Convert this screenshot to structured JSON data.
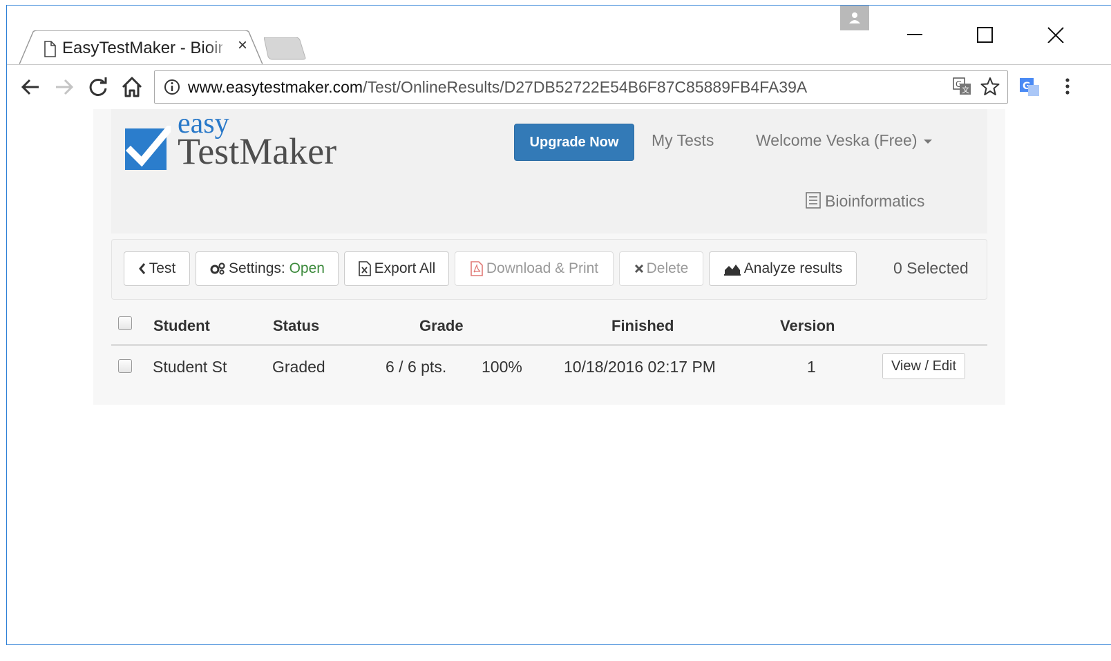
{
  "browser": {
    "tab_title": "EasyTestMaker - Bioinformatics",
    "tab_close": "×",
    "url_host": "www.easytestmaker.com",
    "url_path": "/Test/OnlineResults/D27DB52722E54B6F87C85889FB4FA39A",
    "icons": [
      "page-icon",
      "close-icon",
      "new-tab-icon",
      "profile-icon",
      "minimize-icon",
      "maximize-icon",
      "window-close-icon",
      "back-icon",
      "forward-icon",
      "reload-icon",
      "home-icon",
      "info-icon",
      "translate-icon",
      "star-icon",
      "extension-icon",
      "menu-icon"
    ]
  },
  "header": {
    "logo_easy": "easy",
    "logo_testmaker": "TestMaker",
    "upgrade_label": "Upgrade Now",
    "my_tests_label": "My Tests",
    "welcome_label": "Welcome Veska (Free)",
    "test_name": "Bioinformatics"
  },
  "toolbar": {
    "back_test_label": "Test",
    "settings_label": "Settings:",
    "settings_value": "Open",
    "export_label": "Export All",
    "download_label": "Download & Print",
    "delete_label": "Delete",
    "analyze_label": "Analyze results",
    "selected_count": "0 Selected"
  },
  "table": {
    "columns": [
      "Student",
      "Status",
      "Grade",
      "Finished",
      "Version"
    ],
    "rows": [
      {
        "student": "Student St",
        "status": "Graded",
        "points": "6 / 6 pts.",
        "percent": "100%",
        "finished": "10/18/2016 02:17 PM",
        "version": "1",
        "action_label": "View / Edit"
      }
    ]
  },
  "colors": {
    "primary": "#337ab7",
    "logo_blue": "#2878c8",
    "open_green": "#3c8a3c",
    "pdf_red": "#d9534f"
  }
}
